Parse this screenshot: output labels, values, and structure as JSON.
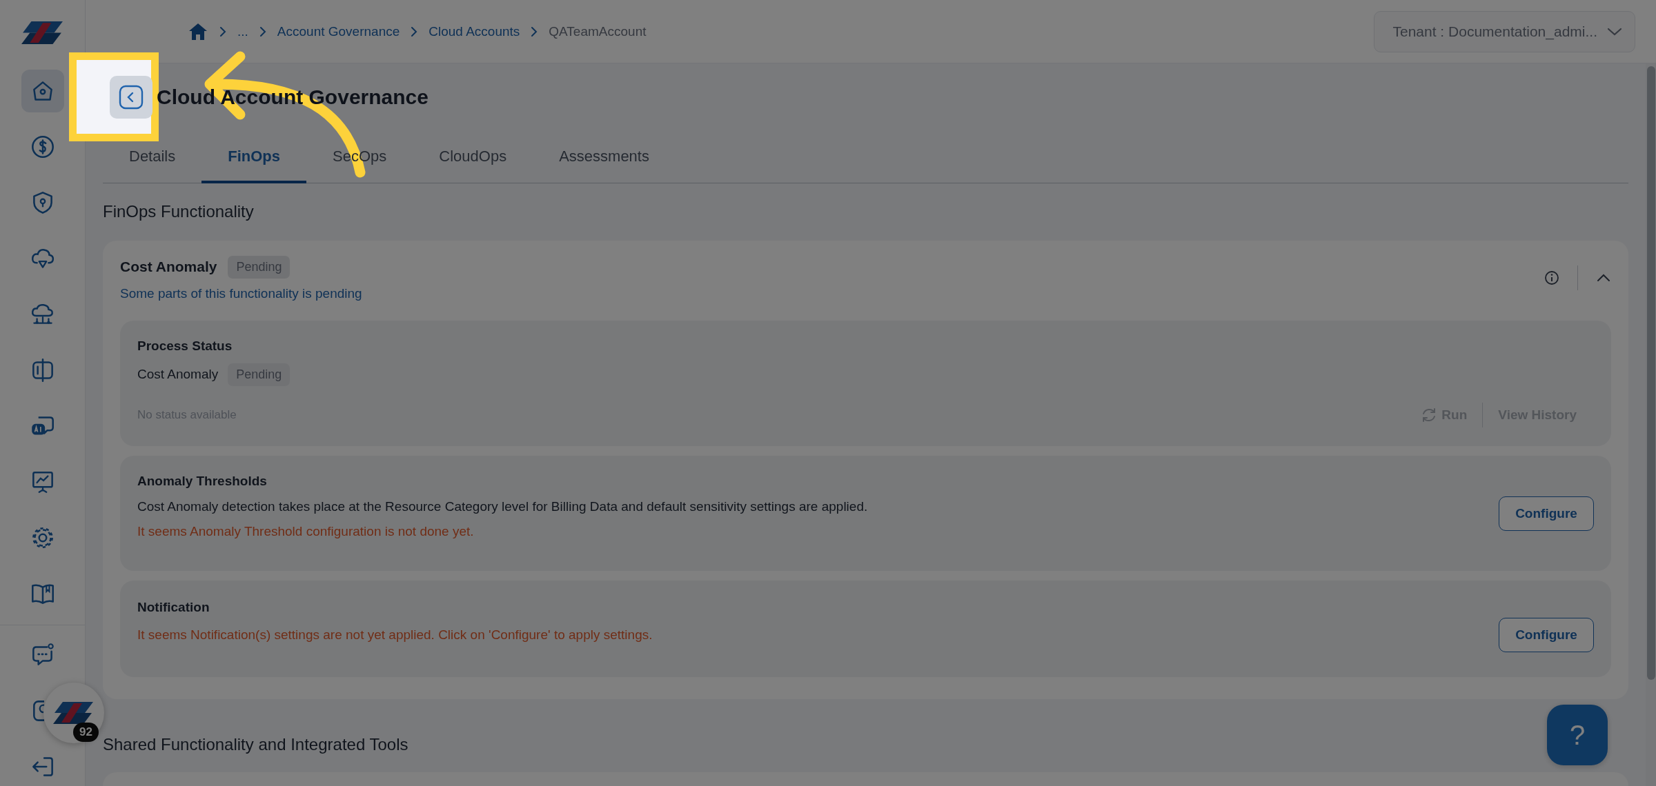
{
  "breadcrumb": [
    {
      "label": "...",
      "kind": "link"
    },
    {
      "label": "Account Governance",
      "kind": "link"
    },
    {
      "label": "Cloud Accounts",
      "kind": "link"
    },
    {
      "label": "QATeamAccount",
      "kind": "current"
    }
  ],
  "tenant": {
    "label": "Tenant : Documentation_admi..."
  },
  "sidebar": {
    "items": [
      {
        "selected": true
      },
      {
        "selected": false
      },
      {
        "selected": false
      },
      {
        "selected": false
      },
      {
        "selected": false
      },
      {
        "selected": false
      },
      {
        "selected": false
      },
      {
        "selected": false
      },
      {
        "selected": false
      },
      {
        "selected": false
      }
    ],
    "bottom_items": [
      {
        "selected": false
      },
      {
        "selected": false
      },
      {
        "selected": false
      }
    ]
  },
  "page_title": "Cloud Account Governance",
  "tabs": [
    {
      "label": "Details",
      "selected": false
    },
    {
      "label": "FinOps",
      "selected": true
    },
    {
      "label": "SecOps",
      "selected": false
    },
    {
      "label": "CloudOps",
      "selected": false
    },
    {
      "label": "Assessments",
      "selected": false
    }
  ],
  "section_title": "FinOps Functionality",
  "card": {
    "title": "Cost Anomaly",
    "badge": "Pending",
    "subtitle": "Some parts of this functionality is pending",
    "expanded": true,
    "process_status": {
      "title": "Process Status",
      "item": "Cost Anomaly",
      "badge": "Pending",
      "status": "No status available",
      "actions": [
        {
          "label": "Run",
          "disabled": true
        },
        {
          "label": "View History",
          "disabled": true
        }
      ]
    },
    "thresholds": {
      "title": "Anomaly Thresholds",
      "description": "Cost Anomaly detection takes place at the Resource Category level for Billing Data and default sensitivity settings are applied.",
      "warning": "It seems Anomaly Threshold configuration is not done yet.",
      "button": "Configure"
    },
    "notification": {
      "title": "Notification",
      "warning": "It seems Notification(s) settings are not yet applied. Click on 'Configure' to apply settings.",
      "button": "Configure"
    }
  },
  "shared_section_title": "Shared Functionality and Integrated Tools",
  "launcher": {
    "badge": "92"
  },
  "help_button": {
    "label": "?"
  }
}
